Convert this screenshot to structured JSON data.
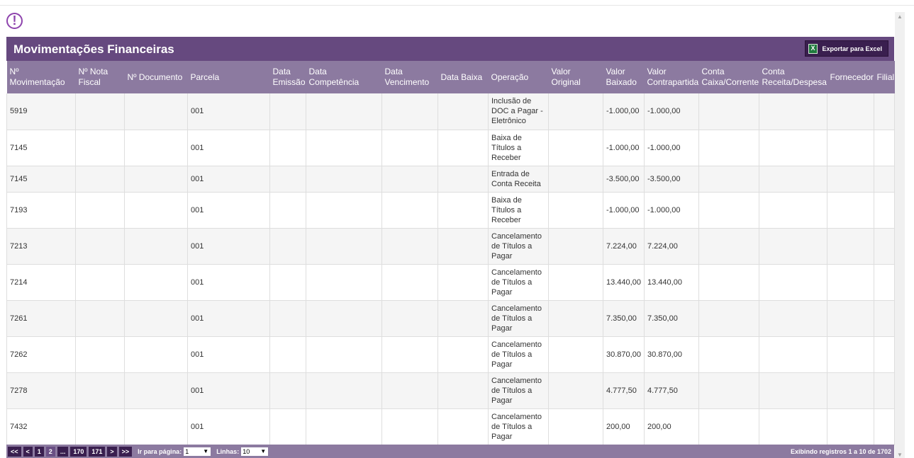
{
  "alert": {
    "symbol": "!"
  },
  "panel": {
    "title": "Movimentações Financeiras",
    "export_label": "Exportar para Excel"
  },
  "table": {
    "columns": [
      "Nº Movimentação",
      "Nº Nota Fiscal",
      "Nº Documento",
      "Parcela",
      "Data Emissão",
      "Data Competência",
      "Data Vencimento",
      "Data Baixa",
      "Operação",
      "Valor Original",
      "Valor Baixado",
      "Valor Contrapartida",
      "Conta Caixa/Corrente",
      "Conta Receita/Despesa",
      "Fornecedor",
      "Filial"
    ],
    "rows": [
      {
        "mov": "5919",
        "parcela": "001",
        "operacao": "Inclusão de DOC a Pagar - Eletrônico",
        "baixado": "-1.000,00",
        "contrapartida": "-1.000,00"
      },
      {
        "mov": "7145",
        "parcela": "001",
        "operacao": "Baixa de Títulos a Receber",
        "baixado": "-1.000,00",
        "contrapartida": "-1.000,00"
      },
      {
        "mov": "7145",
        "parcela": "001",
        "operacao": "Entrada de Conta Receita",
        "baixado": "-3.500,00",
        "contrapartida": "-3.500,00"
      },
      {
        "mov": "7193",
        "parcela": "001",
        "operacao": "Baixa de Títulos a Receber",
        "baixado": "-1.000,00",
        "contrapartida": "-1.000,00"
      },
      {
        "mov": "7213",
        "parcela": "001",
        "operacao": "Cancelamento de Títulos a Pagar",
        "baixado": "7.224,00",
        "contrapartida": "7.224,00"
      },
      {
        "mov": "7214",
        "parcela": "001",
        "operacao": "Cancelamento de Títulos a Pagar",
        "baixado": "13.440,00",
        "contrapartida": "13.440,00"
      },
      {
        "mov": "7261",
        "parcela": "001",
        "operacao": "Cancelamento de Títulos a Pagar",
        "baixado": "7.350,00",
        "contrapartida": "7.350,00"
      },
      {
        "mov": "7262",
        "parcela": "001",
        "operacao": "Cancelamento de Títulos a Pagar",
        "baixado": "30.870,00",
        "contrapartida": "30.870,00"
      },
      {
        "mov": "7278",
        "parcela": "001",
        "operacao": "Cancelamento de Títulos a Pagar",
        "baixado": "4.777,50",
        "contrapartida": "4.777,50"
      },
      {
        "mov": "7432",
        "parcela": "001",
        "operacao": "Cancelamento de Títulos a Pagar",
        "baixado": "200,00",
        "contrapartida": "200,00"
      }
    ]
  },
  "pager": {
    "buttons": [
      "<<",
      "<",
      "1",
      "2",
      "...",
      "170",
      "171",
      ">",
      ">>"
    ],
    "current_page": "2",
    "goto_label": "Ir para página:",
    "goto_value": "1",
    "lines_label": "Linhas:",
    "lines_value": "10",
    "info": "Exibindo registros 1 a 10 de 1702"
  },
  "colors": {
    "header": "#66497f",
    "column_header": "#8c7aa0",
    "button": "#3a1f4f",
    "alert": "#8e44ad"
  }
}
